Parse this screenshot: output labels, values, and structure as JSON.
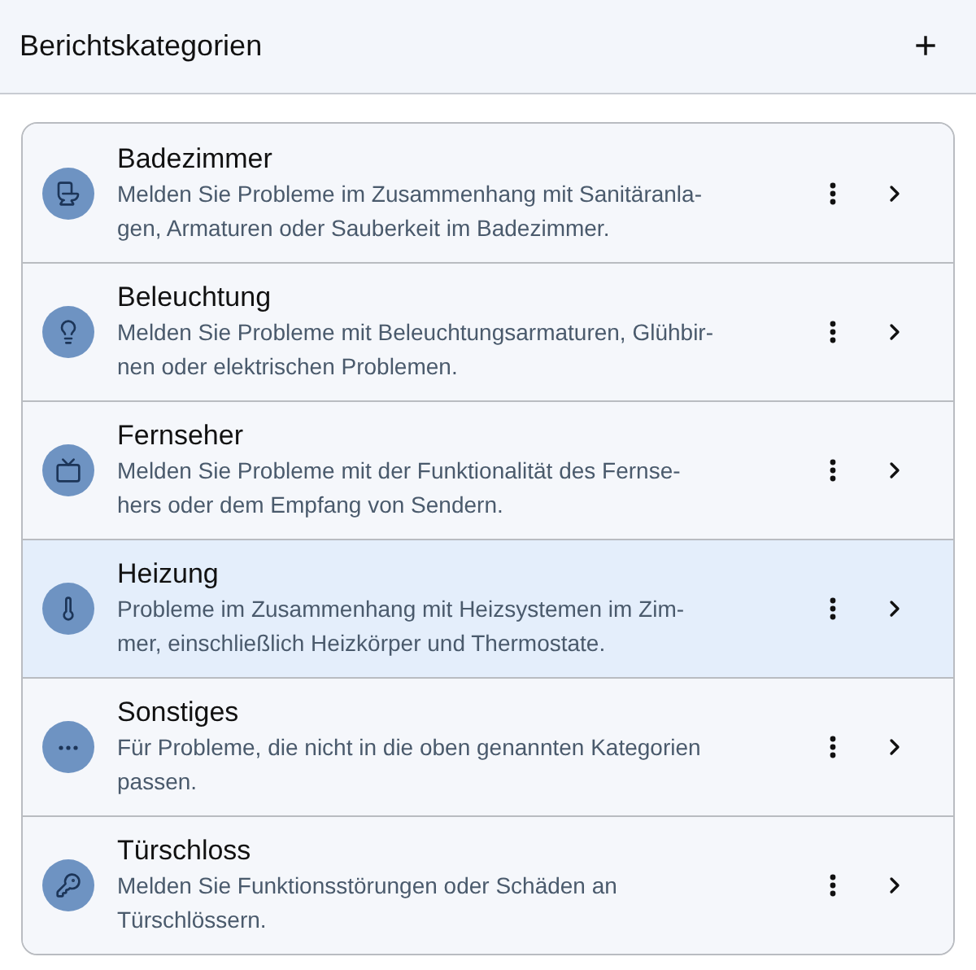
{
  "header": {
    "title": "Berichtskategorien",
    "add_button": "+"
  },
  "categories": [
    {
      "kind": "toilet",
      "title": "Badezimmer",
      "description_lines": [
        "Melden Sie Probleme im Zusammenhang mit Sanitäranla-",
        "gen, Armaturen oder Sauberkeit im Badezimmer."
      ],
      "selected": false
    },
    {
      "kind": "lightbulb",
      "title": "Beleuchtung",
      "description_lines": [
        "Melden Sie Probleme mit Beleuchtungsarmaturen, Glühbir-",
        "nen oder elektrischen Problemen."
      ],
      "selected": false
    },
    {
      "kind": "tv",
      "title": "Fernseher",
      "description_lines": [
        "Melden Sie Probleme mit der Funktionalität des Fernse-",
        "hers oder dem Empfang von Sendern."
      ],
      "selected": false
    },
    {
      "kind": "thermometer",
      "title": "Heizung",
      "description_lines": [
        "Probleme im Zusammenhang mit Heizsystemen im Zim-",
        "mer, einschließlich Heizkörper und Thermostate."
      ],
      "selected": true
    },
    {
      "kind": "ellipsis",
      "title": "Sonstiges",
      "description_lines": [
        "Für Probleme, die nicht in die oben genannten Kategorien",
        "passen."
      ],
      "selected": false
    },
    {
      "kind": "key",
      "title": "Türschloss",
      "description_lines": [
        "Melden Sie Funktionsstörungen oder Schäden an",
        "Türschlössern."
      ],
      "selected": false
    }
  ]
}
